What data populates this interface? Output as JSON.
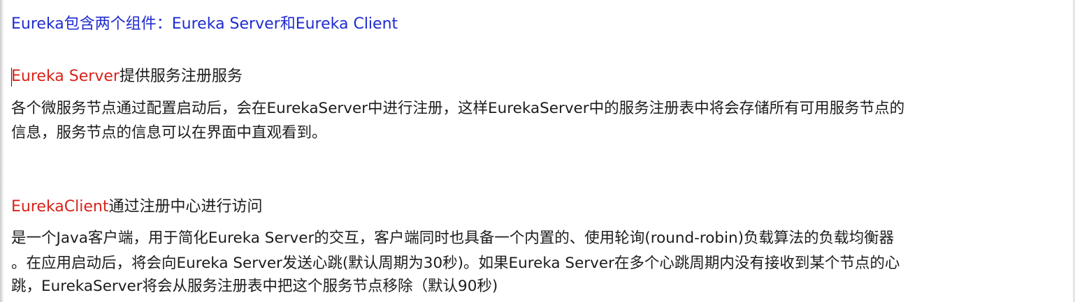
{
  "intro": {
    "text": "Eureka包含两个组件：Eureka Server和Eureka Client"
  },
  "server": {
    "title_highlight": "Eureka Server",
    "title_rest": "提供服务注册服务",
    "description_lines": [
      "各个微服务节点通过配置启动后，会在EurekaServer中进行注册，这样EurekaServer中的服务注册表中将会存储所有可用服务节点的",
      "信息，服务节点的信息可以在界面中直观看到。"
    ]
  },
  "client": {
    "title_highlight": "EurekaClient",
    "title_rest": "通过注册中心进行访问",
    "description_lines": [
      "是一个Java客户端，用于简化Eureka Server的交互，客户端同时也具备一个内置的、使用轮询(round-robin)负载算法的负载均衡器",
      "。在应用启动后，将会向Eureka Server发送心跳(默认周期为30秒)。如果Eureka Server在多个心跳周期内没有接收到某个节点的心",
      "跳，EurekaServer将会从服务注册表中把这个服务节点移除（默认90秒)"
    ]
  },
  "colors": {
    "heading_blue": "#1f2bd0",
    "highlight_red": "#d8231a",
    "text": "#1c1c1c"
  }
}
